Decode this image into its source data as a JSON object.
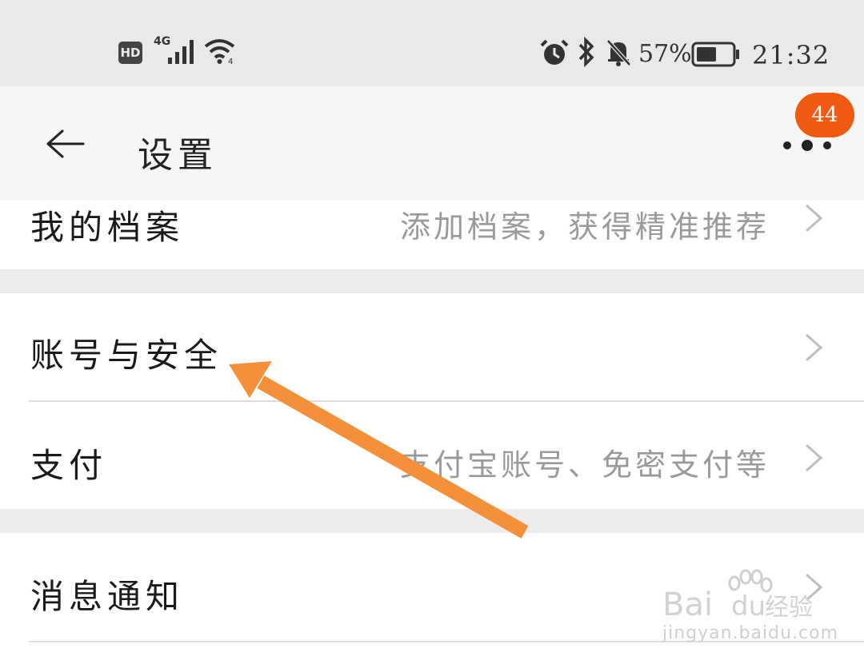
{
  "status_bar": {
    "hd": "HD",
    "network": "4G",
    "battery_percent": "57%",
    "battery_level": 0.57,
    "time": "21:32",
    "icons": [
      "hd-icon",
      "signal-icon",
      "wifi-icon",
      "alarm-icon",
      "bluetooth-icon",
      "mute-icon",
      "battery-icon"
    ]
  },
  "header": {
    "title": "设置",
    "notification_count": "44",
    "icons": [
      "back-arrow-icon",
      "more-dots-icon"
    ]
  },
  "settings_items": [
    {
      "label": "我的档案",
      "hint": "添加档案，获得精准推荐"
    },
    {
      "label": "账号与安全",
      "hint": ""
    },
    {
      "label": "支付",
      "hint": "支付宝账号、免密支付等"
    },
    {
      "label": "消息通知",
      "hint": ""
    }
  ],
  "annotation": {
    "color": "#f5903a",
    "icon": "arrow-annotation"
  },
  "watermark": {
    "text": "Bai du 经验",
    "sub": "jingyan.baidu.com"
  }
}
